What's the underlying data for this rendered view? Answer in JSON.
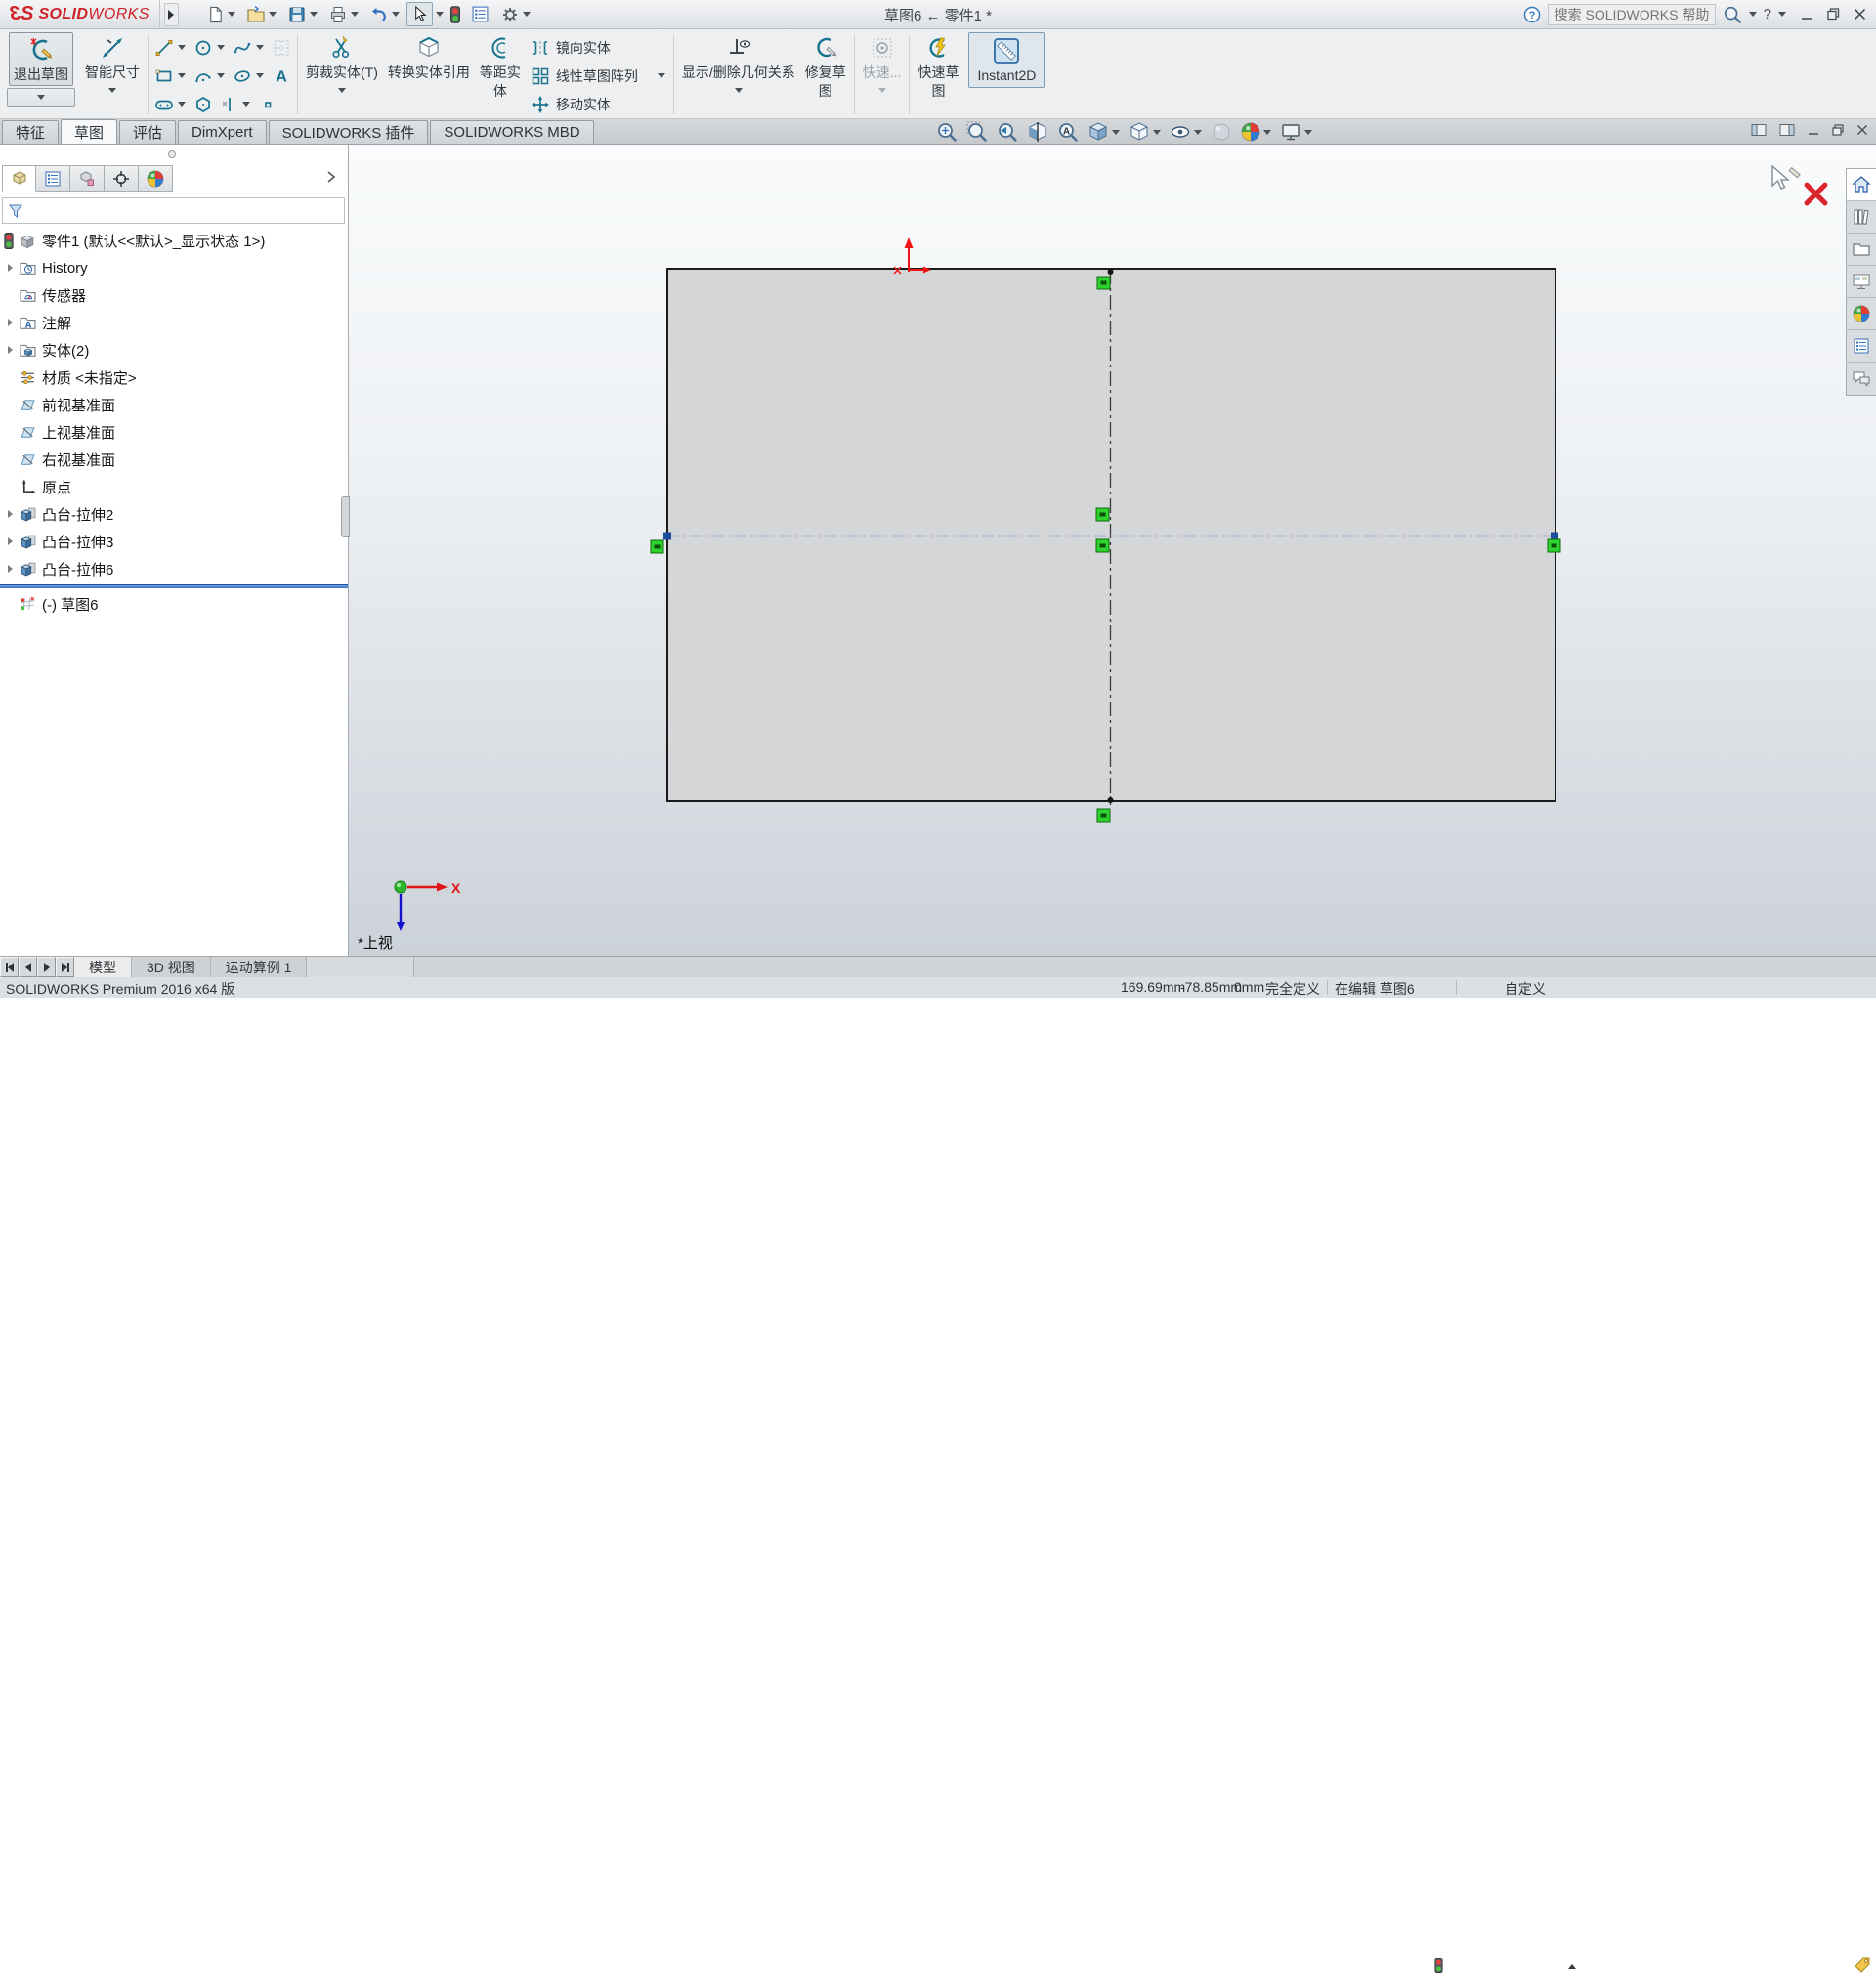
{
  "titlebar": {
    "logo_3": "3",
    "logo_s": "S",
    "brand_bold": "SOLID",
    "brand_light": "WORKS",
    "title": "草图6 ← 零件1 *",
    "search_placeholder": "搜索 SOLIDWORKS 帮助",
    "help_mark": "?"
  },
  "quick_toolbar_icons": [
    "new-file",
    "open-file",
    "save",
    "print",
    "undo",
    "select-cursor",
    "rebuild-traffic-light",
    "file-properties",
    "options-gear"
  ],
  "ribbon": {
    "exit_sketch": "退出草图",
    "smart_dimension": "智能尺寸",
    "trim_entities": "剪裁实体(T)",
    "convert_entities": "转换实体引用",
    "offset_entities_line1": "等距实",
    "offset_entities_line2": "体",
    "mirror_entities": "镜向实体",
    "linear_sketch_pattern": "线性草图阵列",
    "move_entities": "移动实体",
    "display_delete_relations": "显示/删除几何关系",
    "repair_sketch_line1": "修复草",
    "repair_sketch_line2": "图",
    "quick_snaps": "快速...",
    "rapid_sketch_line1": "快速草",
    "rapid_sketch_line2": "图",
    "instant2d": "Instant2D"
  },
  "command_tabs": {
    "items": [
      "特征",
      "草图",
      "评估",
      "DimXpert",
      "SOLIDWORKS 插件",
      "SOLIDWORKS MBD"
    ],
    "active": "草图"
  },
  "headsup_icons": [
    "zoom-to-fit",
    "zoom-to-area",
    "previous-view",
    "section-view",
    "annotation-views",
    "view-orientation",
    "display-style",
    "hide-show-items",
    "edit-appearance",
    "apply-scene",
    "view-settings"
  ],
  "feature_tree": {
    "root": "零件1 (默认<<默认>_显示状态 1>)",
    "items": [
      "History",
      "传感器",
      "注解",
      "实体(2)",
      "材质 <未指定>",
      "前视基准面",
      "上视基准面",
      "右视基准面",
      "原点",
      "凸台-拉伸2",
      "凸台-拉伸3",
      "凸台-拉伸6",
      "(-) 草图6"
    ]
  },
  "panel_tab_icons": [
    "featuremanager-tree",
    "propertymanager",
    "configurationmanager",
    "dimxpertmanager",
    "displaymanager"
  ],
  "task_pane_icons": [
    "solidworks-resources-home",
    "design-library",
    "file-explorer",
    "view-palette",
    "appearances-scenes",
    "custom-properties",
    "solidworks-forum"
  ],
  "viewport": {
    "view_label": "*上视",
    "axis_x_label": "X"
  },
  "bottom_tabs": {
    "items": [
      "模型",
      "3D 视图",
      "运动算例 1"
    ],
    "active": "模型"
  },
  "statusbar": {
    "product": "SOLIDWORKS Premium 2016 x64 版",
    "coord_x": "169.69mm",
    "coord_y": "-78.85mm",
    "coord_z": "0mm",
    "sketch_state": "完全定义",
    "editing": "在编辑 草图6",
    "units": "自定义"
  },
  "colors": {
    "relation_green": "#2fd32f",
    "selected_blue": "#6b94cf",
    "origin_red": "#f01616",
    "accent_teal": "#177390",
    "brand_red": "#cf2128",
    "rollback_blue": "#2f6fc4"
  }
}
